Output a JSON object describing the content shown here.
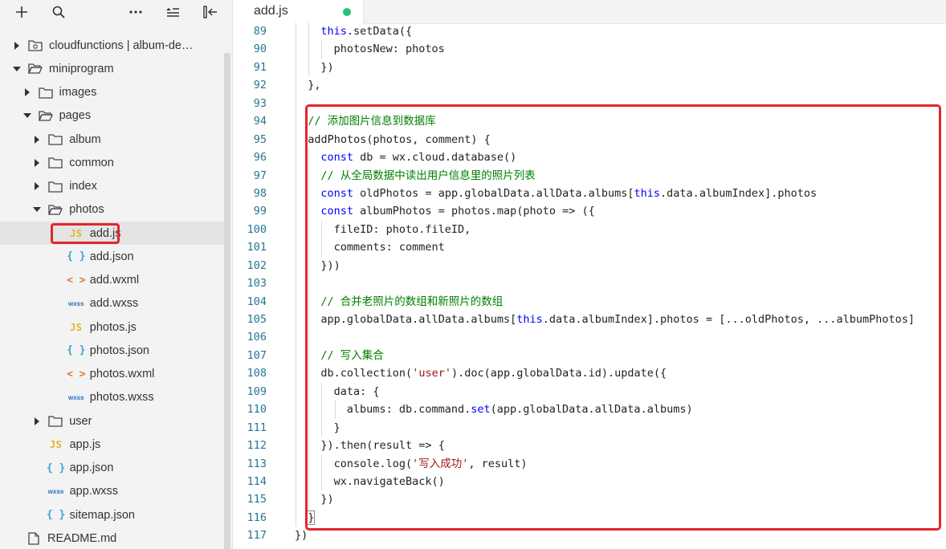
{
  "sidebar": {
    "toolbar": {
      "add_icon": "plus-icon",
      "search_icon": "search-icon",
      "more_icon": "more-icon",
      "collapse_icon": "collapse-icon",
      "layout_icon": "layout-icon"
    },
    "tree": [
      {
        "label": "cloudfunctions | album-de…",
        "type": "cloud-folder",
        "depth": 0,
        "expanded": false
      },
      {
        "label": "miniprogram",
        "type": "folder",
        "depth": 0,
        "expanded": true
      },
      {
        "label": "images",
        "type": "folder",
        "depth": 1,
        "expanded": false
      },
      {
        "label": "pages",
        "type": "folder",
        "depth": 1,
        "expanded": true
      },
      {
        "label": "album",
        "type": "folder",
        "depth": 2,
        "expanded": false
      },
      {
        "label": "common",
        "type": "folder",
        "depth": 2,
        "expanded": false
      },
      {
        "label": "index",
        "type": "folder",
        "depth": 2,
        "expanded": false
      },
      {
        "label": "photos",
        "type": "folder",
        "depth": 2,
        "expanded": true
      },
      {
        "label": "add.js",
        "type": "js",
        "depth": 3,
        "selected": true,
        "badge": "JS"
      },
      {
        "label": "add.json",
        "type": "json",
        "depth": 3,
        "badge": "{ }"
      },
      {
        "label": "add.wxml",
        "type": "wxml",
        "depth": 3,
        "badge": "< >"
      },
      {
        "label": "add.wxss",
        "type": "wxss",
        "depth": 3,
        "badge": "wxss"
      },
      {
        "label": "photos.js",
        "type": "js",
        "depth": 3,
        "badge": "JS"
      },
      {
        "label": "photos.json",
        "type": "json",
        "depth": 3,
        "badge": "{ }"
      },
      {
        "label": "photos.wxml",
        "type": "wxml",
        "depth": 3,
        "badge": "< >"
      },
      {
        "label": "photos.wxss",
        "type": "wxss",
        "depth": 3,
        "badge": "wxss"
      },
      {
        "label": "user",
        "type": "folder",
        "depth": 2,
        "expanded": false
      },
      {
        "label": "app.js",
        "type": "js",
        "depth": 1,
        "badge": "JS"
      },
      {
        "label": "app.json",
        "type": "json",
        "depth": 1,
        "badge": "{ }"
      },
      {
        "label": "app.wxss",
        "type": "wxss",
        "depth": 1,
        "badge": "wxss"
      },
      {
        "label": "sitemap.json",
        "type": "json",
        "depth": 1,
        "badge": "{ }"
      },
      {
        "label": "README.md",
        "type": "file",
        "depth": 0
      }
    ]
  },
  "editor": {
    "tab": {
      "label": "add.js",
      "modified_color": "#21c27a"
    },
    "lines": [
      {
        "n": "89",
        "indent": 2,
        "tokens": [
          [
            "kw",
            "this"
          ],
          [
            "p",
            ".setData({"
          ]
        ]
      },
      {
        "n": "90",
        "indent": 3,
        "tokens": [
          [
            "p",
            "photosNew: photos"
          ]
        ]
      },
      {
        "n": "91",
        "indent": 2,
        "tokens": [
          [
            "p",
            "})"
          ]
        ]
      },
      {
        "n": "92",
        "indent": 1,
        "tokens": [
          [
            "p",
            "},"
          ]
        ]
      },
      {
        "n": "93",
        "indent": 1,
        "tokens": []
      },
      {
        "n": "94",
        "indent": 1,
        "tokens": [
          [
            "cm",
            "// 添加图片信息到数据库"
          ]
        ]
      },
      {
        "n": "95",
        "indent": 1,
        "tokens": [
          [
            "p",
            "addPhotos(photos, comment) {"
          ]
        ]
      },
      {
        "n": "96",
        "indent": 2,
        "tokens": [
          [
            "kw",
            "const"
          ],
          [
            "p",
            " db = wx.cloud.database()"
          ]
        ]
      },
      {
        "n": "97",
        "indent": 2,
        "tokens": [
          [
            "cm",
            "// 从全局数据中读出用户信息里的照片列表"
          ]
        ]
      },
      {
        "n": "98",
        "indent": 2,
        "tokens": [
          [
            "kw",
            "const"
          ],
          [
            "p",
            " oldPhotos = app.globalData.allData.albums["
          ],
          [
            "kw",
            "this"
          ],
          [
            "p",
            ".data.albumIndex].photos"
          ]
        ]
      },
      {
        "n": "99",
        "indent": 2,
        "tokens": [
          [
            "kw",
            "const"
          ],
          [
            "p",
            " albumPhotos = photos.map(photo => ({"
          ]
        ]
      },
      {
        "n": "100",
        "indent": 3,
        "tokens": [
          [
            "p",
            "fileID: photo.fileID,"
          ]
        ]
      },
      {
        "n": "101",
        "indent": 3,
        "tokens": [
          [
            "p",
            "comments: comment"
          ]
        ]
      },
      {
        "n": "102",
        "indent": 2,
        "tokens": [
          [
            "p",
            "}))"
          ]
        ]
      },
      {
        "n": "103",
        "indent": 2,
        "tokens": []
      },
      {
        "n": "104",
        "indent": 2,
        "tokens": [
          [
            "cm",
            "// 合并老照片的数组和新照片的数组"
          ]
        ]
      },
      {
        "n": "105",
        "indent": 2,
        "tokens": [
          [
            "p",
            "app.globalData.allData.albums["
          ],
          [
            "kw",
            "this"
          ],
          [
            "p",
            ".data.albumIndex].photos = [...oldPhotos, ...albumPhotos]"
          ]
        ]
      },
      {
        "n": "106",
        "indent": 2,
        "tokens": []
      },
      {
        "n": "107",
        "indent": 2,
        "tokens": [
          [
            "cm",
            "// 写入集合"
          ]
        ]
      },
      {
        "n": "108",
        "indent": 2,
        "tokens": [
          [
            "p",
            "db.collection("
          ],
          [
            "str",
            "'user'"
          ],
          [
            "p",
            ").doc(app.globalData.id).update({"
          ]
        ]
      },
      {
        "n": "109",
        "indent": 3,
        "tokens": [
          [
            "p",
            "data: {"
          ]
        ]
      },
      {
        "n": "110",
        "indent": 4,
        "tokens": [
          [
            "p",
            "albums: db.command."
          ],
          [
            "kw",
            "set"
          ],
          [
            "p",
            "(app.globalData.allData.albums)"
          ]
        ]
      },
      {
        "n": "111",
        "indent": 3,
        "tokens": [
          [
            "p",
            "}"
          ]
        ]
      },
      {
        "n": "112",
        "indent": 2,
        "tokens": [
          [
            "p",
            "}).then(result => {"
          ]
        ]
      },
      {
        "n": "113",
        "indent": 3,
        "tokens": [
          [
            "p",
            "console.log("
          ],
          [
            "str",
            "'写入成功'"
          ],
          [
            "p",
            ", result)"
          ]
        ]
      },
      {
        "n": "114",
        "indent": 3,
        "tokens": [
          [
            "p",
            "wx.navigateBack()"
          ]
        ]
      },
      {
        "n": "115",
        "indent": 2,
        "tokens": [
          [
            "p",
            "})"
          ]
        ]
      },
      {
        "n": "116",
        "indent": 1,
        "tokens": [
          [
            "cur",
            "}"
          ]
        ]
      },
      {
        "n": "117",
        "indent": 0,
        "tokens": [
          [
            "p",
            "})"
          ]
        ]
      }
    ]
  },
  "colors": {
    "highlight": "#e3262d",
    "keyword": "#0000ff",
    "comment": "#008000",
    "string": "#a31515",
    "line_number": "#237893"
  }
}
